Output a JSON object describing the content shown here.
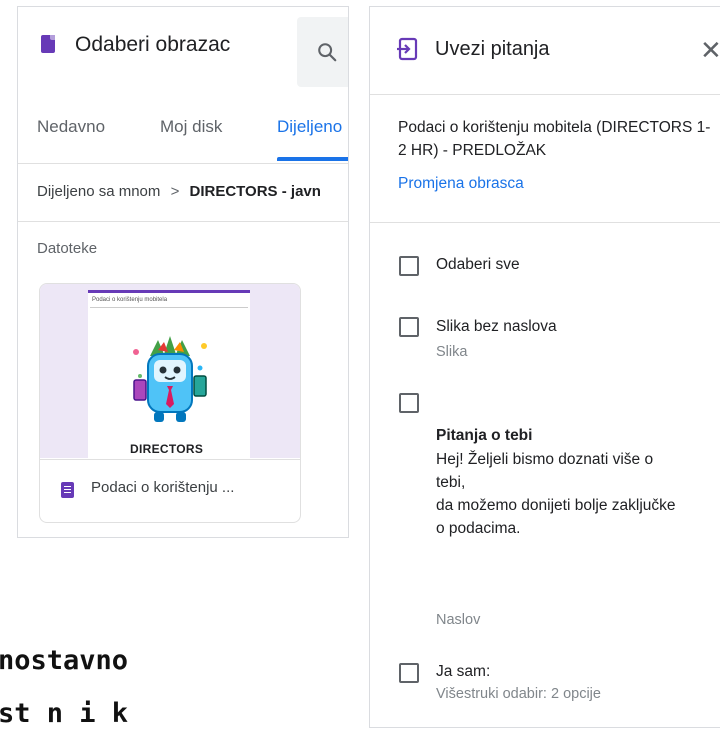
{
  "picker": {
    "title": "Odaberi obrazac",
    "tabs": [
      "Nedavno",
      "Moj disk",
      "Dijeljeno"
    ],
    "active_tab": "Dijeljeno",
    "breadcrumb": {
      "root": "Dijeljeno sa mnom",
      "separator": ">",
      "current": "DIRECTORS - javn"
    },
    "section_label": "Datoteke",
    "file": {
      "thumbnail_title": "Podaci o korištenju mobitela",
      "thumbnail_label": "DIRECTORS",
      "name": "Podaci o korištenju ..."
    }
  },
  "importer": {
    "title": "Uvezi pitanja",
    "form_name": "Podaci o korištenju mobitela (DIRECTORS 1-2 HR) - PREDLOŽAK",
    "change_link": "Promjena obrasca",
    "select_all": "Odaberi sve",
    "items": [
      {
        "title": "Slika bez naslova",
        "subtitle": "Slika"
      },
      {
        "title": "Pitanja o tebi",
        "body": [
          "Hej! Željeli bismo doznati više o",
          "tebi,",
          "da možemo donijeti bolje zaključke",
          "o podacima."
        ],
        "subtitle": "Naslov"
      },
      {
        "title": "Ja sam:",
        "subtitle": "Višestruki odabir: 2 opcije"
      }
    ]
  },
  "slide_text": [
    "nostavno",
    "st  n i  k"
  ],
  "colors": {
    "accent": "#1a73e8",
    "form_purple": "#673ab7",
    "thumbnail_bg": "#ede7f6"
  }
}
